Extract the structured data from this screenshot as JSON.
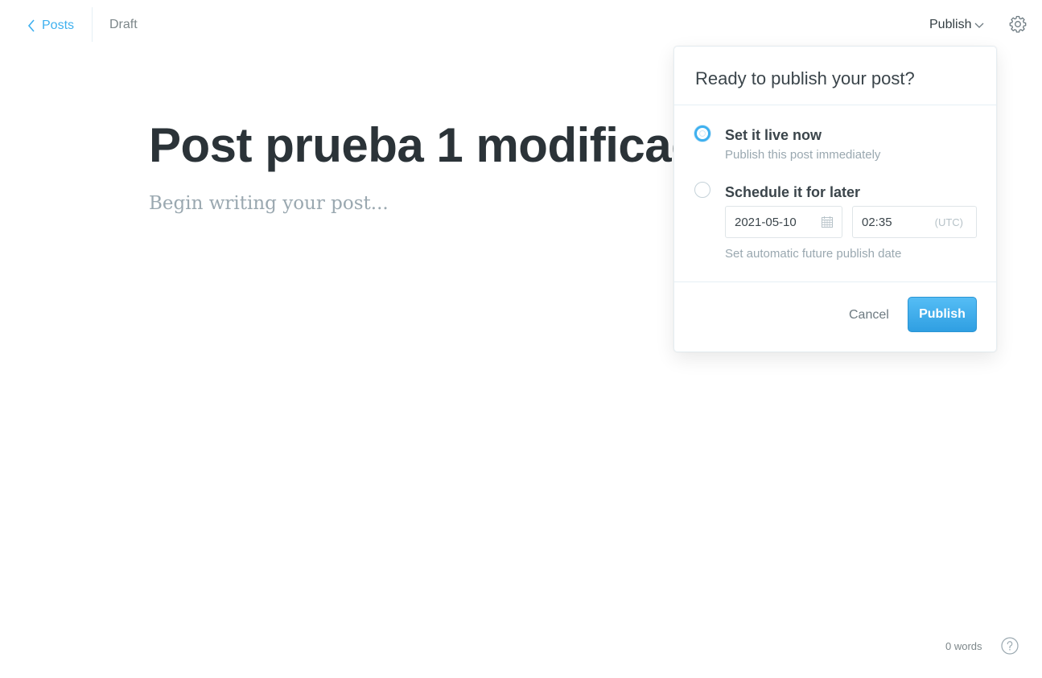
{
  "topbar": {
    "back_label": "Posts",
    "status": "Draft",
    "publish_menu_label": "Publish",
    "icons": [
      "chevron-left-icon",
      "chevron-down-icon",
      "gear-icon"
    ]
  },
  "editor": {
    "title": "Post prueba 1 modificado",
    "body_placeholder": "Begin writing your post..."
  },
  "publish_popover": {
    "title": "Ready to publish your post?",
    "options": [
      {
        "label": "Set it live now",
        "description": "Publish this post immediately",
        "selected": true
      },
      {
        "label": "Schedule it for later",
        "description": "Set automatic future publish date",
        "selected": false
      }
    ],
    "schedule": {
      "date": "2021-05-10",
      "time": "02:35",
      "timezone": "(UTC)"
    },
    "cancel_label": "Cancel",
    "publish_label": "Publish"
  },
  "footer": {
    "word_count": "0 words",
    "icons": [
      "help-icon"
    ]
  },
  "colors": {
    "accent": "#3eb0ef",
    "title_text": "#2b3338",
    "muted_text": "#9aa8b0"
  }
}
